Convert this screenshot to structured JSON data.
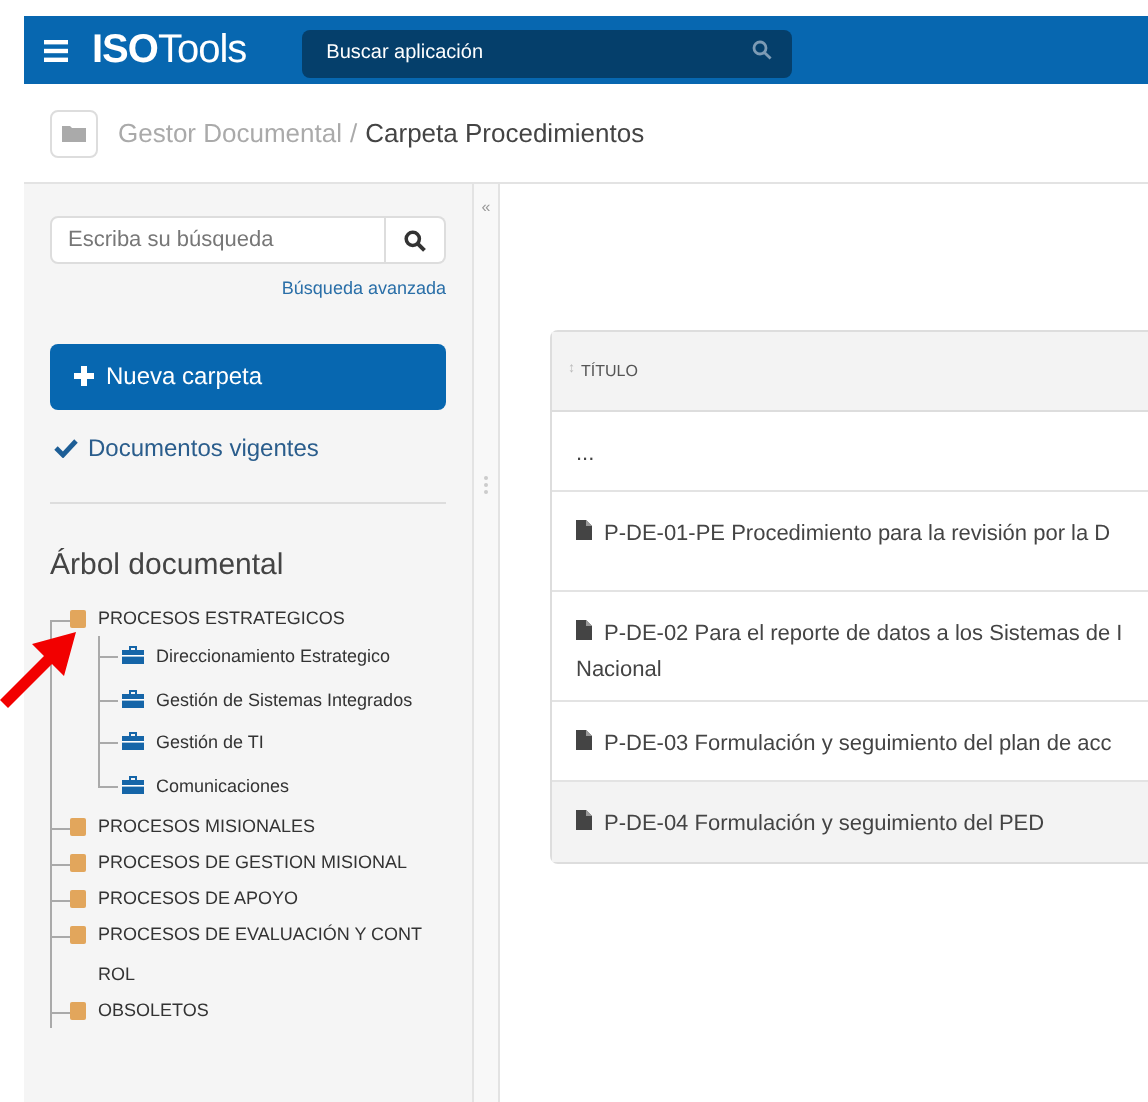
{
  "header": {
    "logo_bold": "ISO",
    "logo_light": "Tools",
    "search": {
      "placeholder": "Buscar aplicación"
    }
  },
  "breadcrumb": [
    "Gestor Documental",
    "/",
    "Carpeta Procedimientos"
  ],
  "sidebar": {
    "search": {
      "placeholder": "Escriba su búsqueda"
    },
    "advanced_link": "Búsqueda avanzada",
    "new_folder_button": "Nueva carpeta",
    "current_docs": {
      "label": "Documentos vigentes",
      "checked": true
    },
    "collapse": "«",
    "tree_title": "Árbol documental",
    "tree": [
      {
        "label": "PROCESOS ESTRATEGICOS",
        "kind": "folder",
        "children": [
          {
            "label": "Direccionamiento Estrategico",
            "kind": "process"
          },
          {
            "label": "Gestión de Sistemas Integrados",
            "kind": "process"
          },
          {
            "label": "Gestión de TI",
            "kind": "process"
          },
          {
            "label": "Comunicaciones",
            "kind": "process"
          }
        ]
      },
      {
        "label": "PROCESOS MISIONALES",
        "kind": "folder"
      },
      {
        "label": "PROCESOS DE GESTION MISIONAL",
        "kind": "folder"
      },
      {
        "label": "PROCESOS DE APOYO",
        "kind": "folder"
      },
      {
        "label": "PROCESOS DE EVALUACIÓN Y CONTROL",
        "kind": "folder"
      },
      {
        "label": "OBSOLETOS",
        "kind": "folder"
      }
    ]
  },
  "table": {
    "columns": [
      {
        "label": "TÍTULO",
        "sort": "↕"
      }
    ],
    "rows": [
      {
        "kind": "parent",
        "lines": [
          "..."
        ],
        "highlighted": false
      },
      {
        "kind": "document",
        "lines": [
          "P-DE-01-PE Procedimiento para la revisión por la D"
        ],
        "highlighted": false
      },
      {
        "kind": "document",
        "lines": [
          "P-DE-02 Para el reporte de datos a los Sistemas de I",
          "Nacional"
        ],
        "highlighted": false
      },
      {
        "kind": "document",
        "lines": [
          "P-DE-03 Formulación y seguimiento del plan de acc"
        ],
        "highlighted": false
      },
      {
        "kind": "document",
        "lines": [
          "P-DE-04 Formulación y seguimiento del PED"
        ],
        "highlighted": true
      }
    ]
  }
}
